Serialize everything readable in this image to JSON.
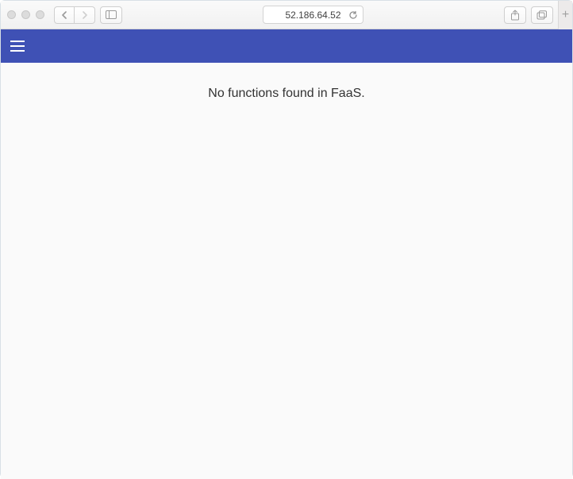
{
  "browser": {
    "address": "52.186.64.52"
  },
  "app": {
    "header_color": "#3f51b5"
  },
  "content": {
    "message": "No functions found in FaaS."
  }
}
